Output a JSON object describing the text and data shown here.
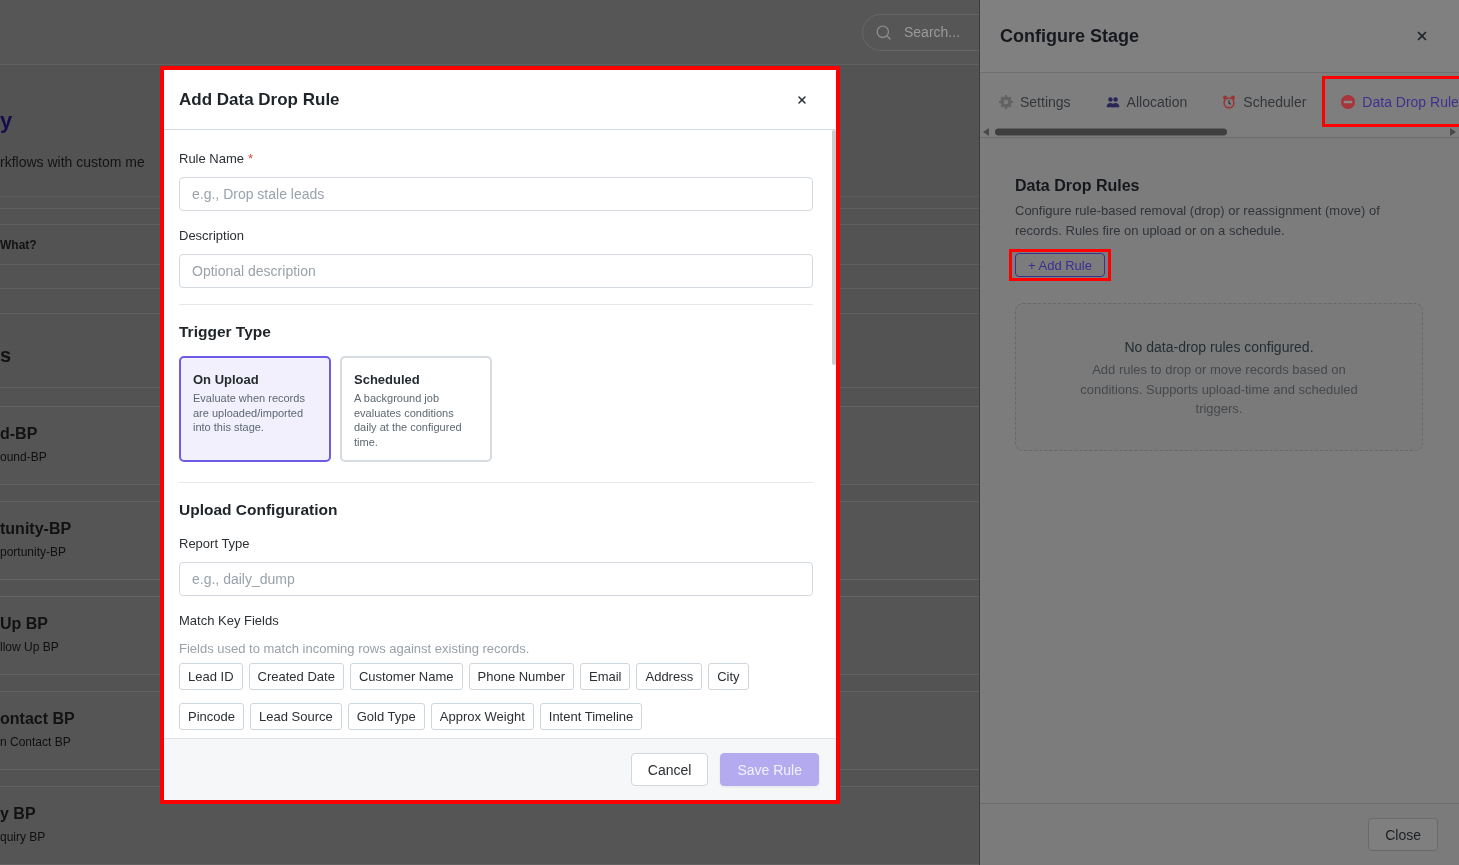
{
  "background_page": {
    "search": {
      "placeholder": "Search..."
    },
    "title": "y",
    "subtitle": "rkflows with custom me",
    "column_header": "What?",
    "section_title": "s",
    "cards": [
      {
        "title": "d-BP",
        "subtitle": "ound-BP"
      },
      {
        "title": "tunity-BP",
        "subtitle": "portunity-BP"
      },
      {
        "title": "Up BP",
        "subtitle": "llow Up BP"
      },
      {
        "title": "ontact BP",
        "subtitle": "n Contact BP"
      },
      {
        "title": "y BP",
        "subtitle": "quiry BP"
      }
    ]
  },
  "drawer": {
    "title": "Configure Stage",
    "tabs": [
      {
        "label": "Settings",
        "selected": false,
        "highlighted": false
      },
      {
        "label": "Allocation",
        "selected": false,
        "highlighted": false
      },
      {
        "label": "Scheduler",
        "selected": false,
        "highlighted": false
      },
      {
        "label": "Data Drop Rule",
        "selected": true,
        "highlighted": true
      }
    ],
    "section": {
      "title": "Data Drop Rules",
      "description": "Configure rule-based removal (drop) or reassignment (move) of records. Rules fire on upload or on a schedule.",
      "add_button": {
        "label": "+ Add Rule",
        "highlighted": true
      }
    },
    "empty_state": {
      "title": "No data-drop rules configured.",
      "description": "Add rules to drop or move records based on conditions. Supports upload-time and scheduled triggers."
    },
    "footer": {
      "close_button": "Close"
    }
  },
  "modal": {
    "title": "Add Data Drop Rule",
    "highlighted": true,
    "fields": [
      {
        "label": "Rule Name",
        "required_mark": "*",
        "placeholder": "e.g., Drop stale leads"
      },
      {
        "label": "Description",
        "placeholder": "Optional description"
      }
    ],
    "trigger_type": {
      "title": "Trigger Type",
      "options": [
        {
          "title": "On Upload",
          "description": "Evaluate when records are uploaded/imported into this stage.",
          "selected": true
        },
        {
          "title": "Scheduled",
          "description": "A background job evaluates conditions daily at the configured time.",
          "selected": false
        }
      ]
    },
    "upload_configuration": {
      "title": "Upload Configuration",
      "report_type": {
        "label": "Report Type",
        "placeholder": "e.g., daily_dump"
      },
      "match_key_fields": {
        "label": "Match Key Fields",
        "hint": "Fields used to match incoming rows against existing records.",
        "chips": [
          {
            "label": "Lead ID",
            "selected": false
          },
          {
            "label": "Created Date",
            "selected": false
          },
          {
            "label": "Customer Name",
            "selected": false
          },
          {
            "label": "Phone Number",
            "selected": false
          },
          {
            "label": "Email",
            "selected": false
          },
          {
            "label": "Address",
            "selected": false
          },
          {
            "label": "City",
            "selected": false
          },
          {
            "label": "Pincode",
            "selected": false
          },
          {
            "label": "Lead Source",
            "selected": false
          },
          {
            "label": "Gold Type",
            "selected": false
          },
          {
            "label": "Approx Weight",
            "selected": false
          },
          {
            "label": "Intent Timeline",
            "selected": false
          }
        ]
      }
    },
    "buttons": [
      {
        "label": "Cancel",
        "kind": "secondary",
        "disabled": false
      },
      {
        "label": "Save Rule",
        "kind": "primary",
        "disabled": true
      }
    ]
  }
}
